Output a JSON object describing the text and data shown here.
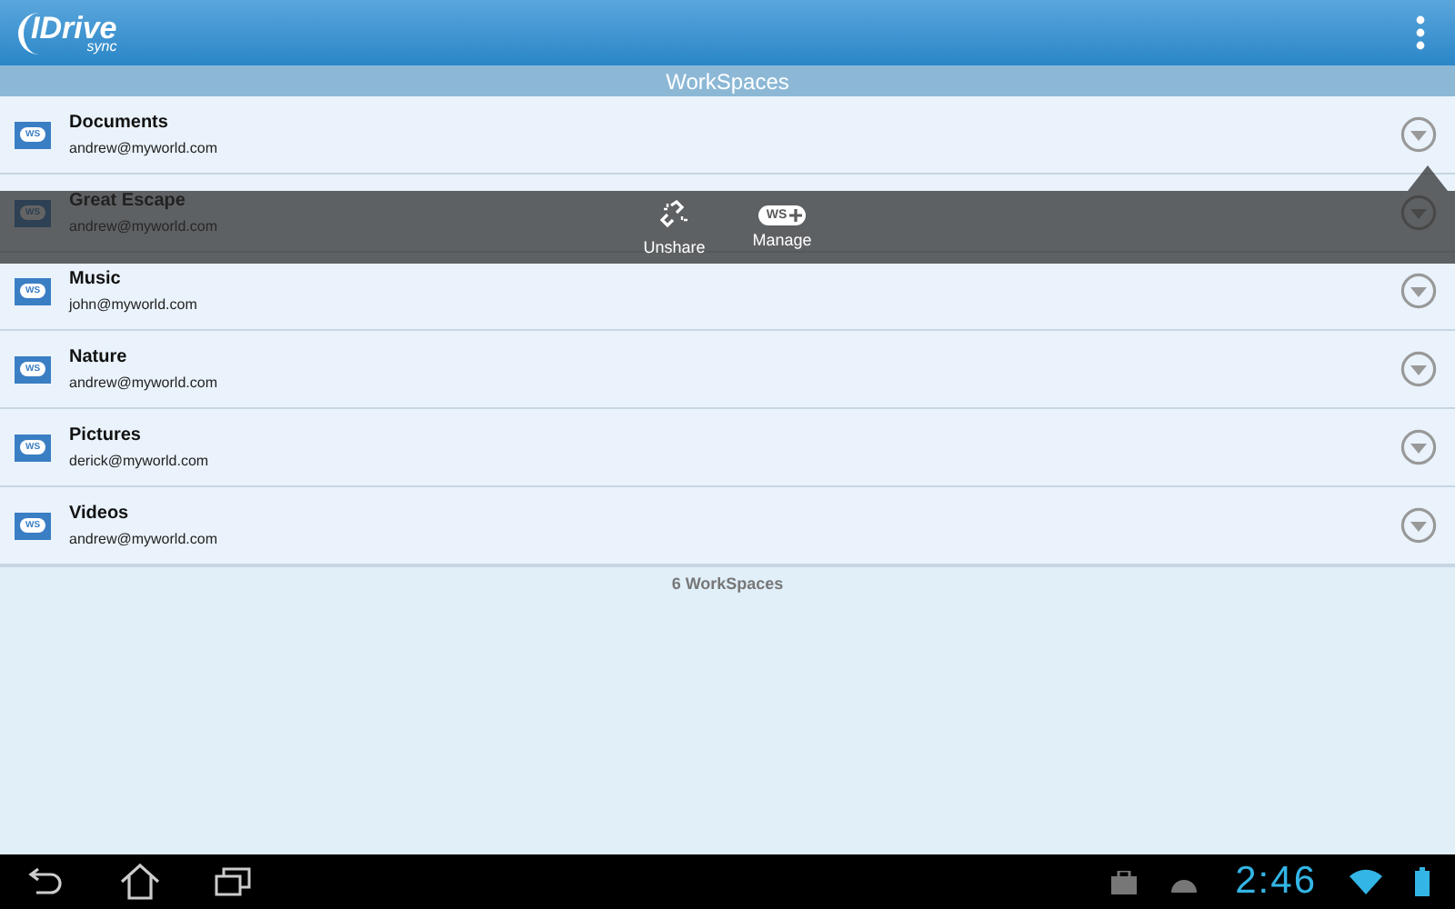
{
  "app_bar": {
    "logo_text": "IDrive",
    "logo_subtext": "sync"
  },
  "title": "WorkSpaces",
  "rows": [
    {
      "name": "Documents",
      "owner": "andrew@myworld.com",
      "badge": "WS"
    },
    {
      "name": "Great Escape",
      "owner": "andrew@myworld.com",
      "badge": "WS"
    },
    {
      "name": "Music",
      "owner": "john@myworld.com",
      "badge": "WS"
    },
    {
      "name": "Nature",
      "owner": "andrew@myworld.com",
      "badge": "WS"
    },
    {
      "name": "Pictures",
      "owner": "derick@myworld.com",
      "badge": "WS"
    },
    {
      "name": "Videos",
      "owner": "andrew@myworld.com",
      "badge": "WS"
    }
  ],
  "popup": {
    "actions": [
      {
        "kind": "unshare",
        "label": "Unshare"
      },
      {
        "kind": "manage",
        "label": "Manage",
        "badge": "WS"
      }
    ]
  },
  "footer": "6 WorkSpaces",
  "status_bar": {
    "time": "2:46"
  }
}
